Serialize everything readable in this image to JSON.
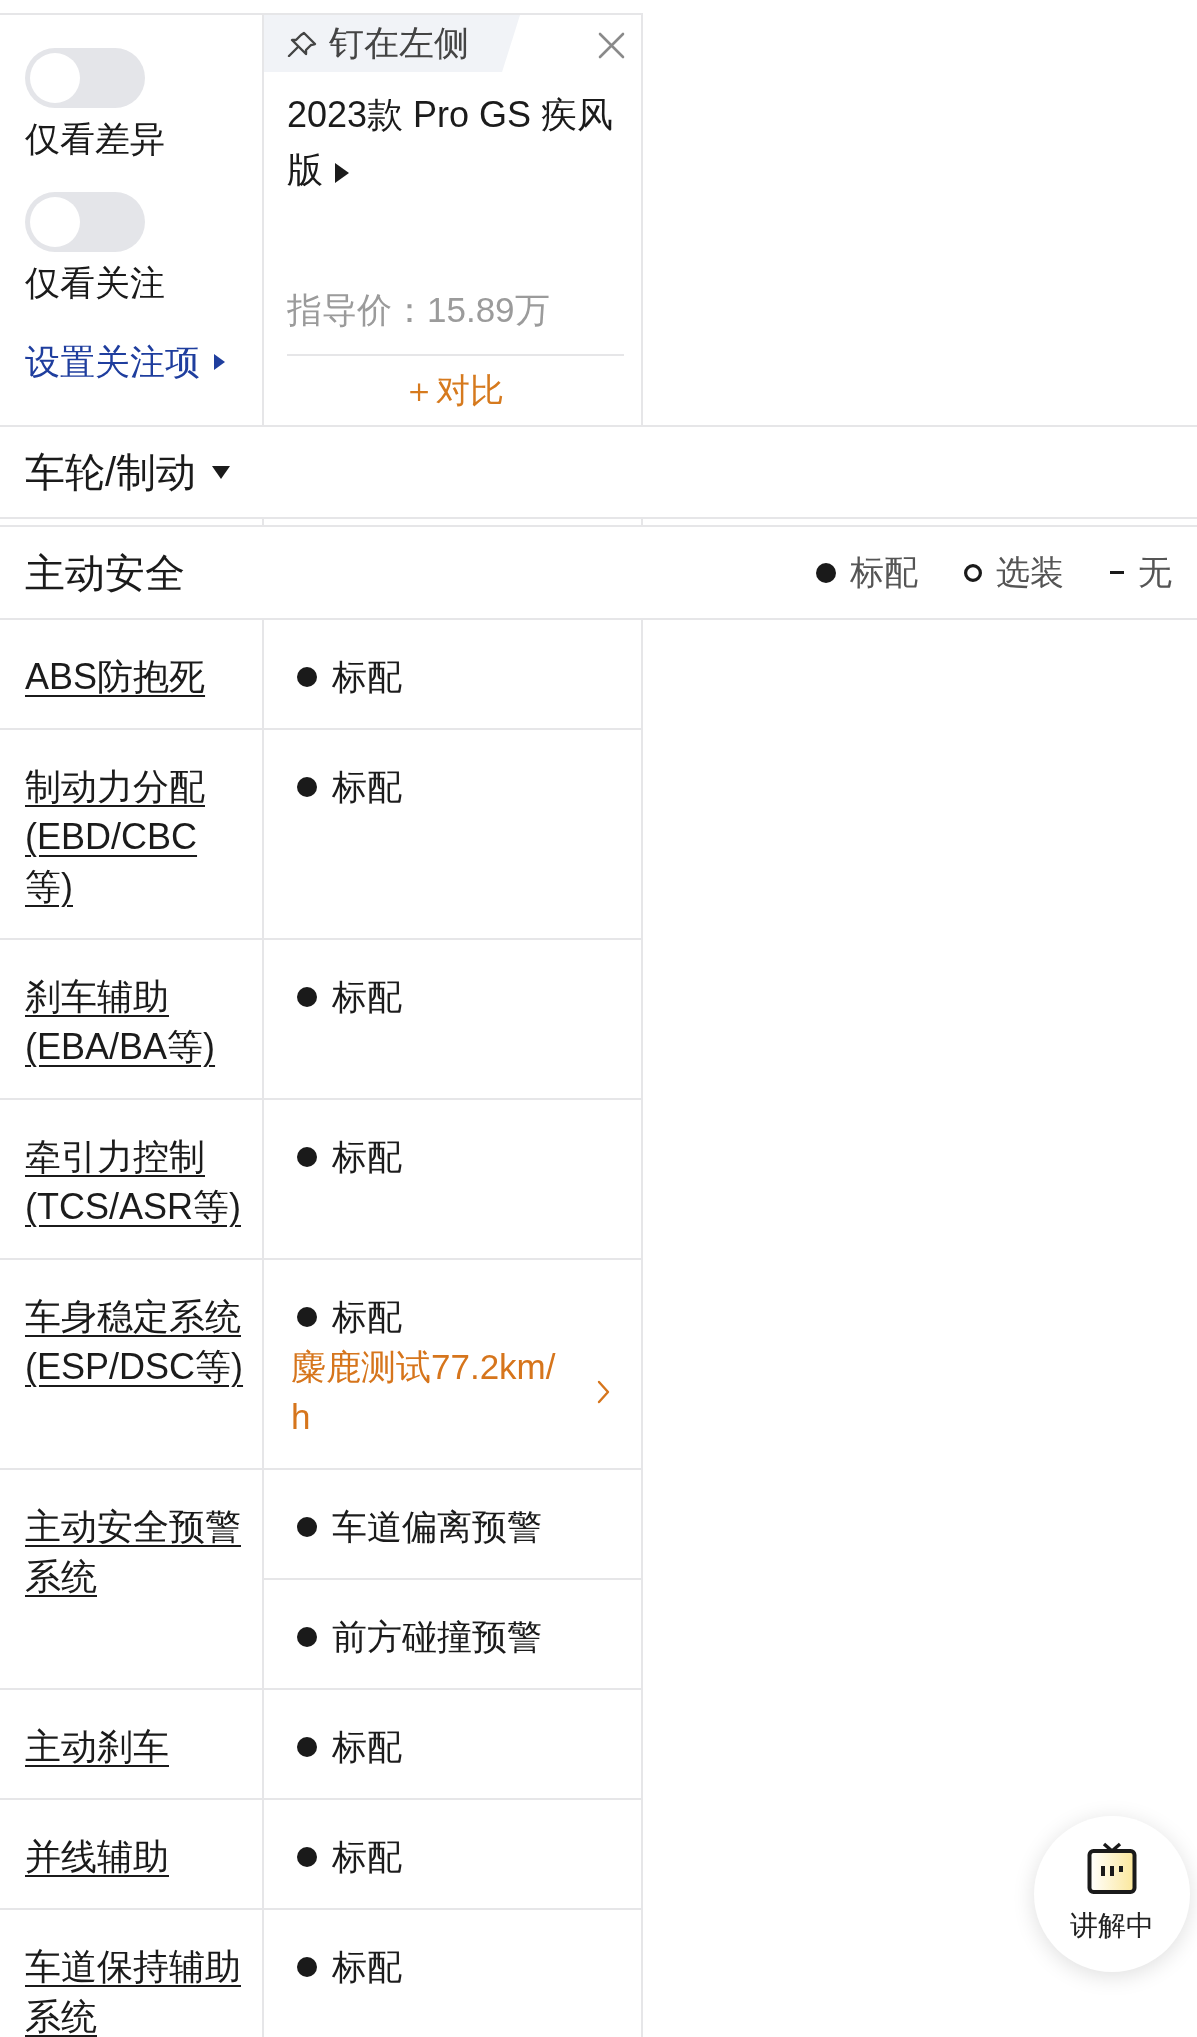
{
  "filters": {
    "toggles": [
      {
        "label": "仅看差异",
        "on": false
      },
      {
        "label": "仅看关注",
        "on": false
      }
    ],
    "settings_link": "设置关注项"
  },
  "car": {
    "pin_label": "钉在左侧",
    "title": "2023款 Pro GS 疾风版",
    "price": "指导价：15.89万",
    "compare_button": "＋对比"
  },
  "section": {
    "title": "车轮/制动"
  },
  "group": {
    "title": "主动安全",
    "legend": [
      {
        "kind": "standard",
        "label": "标配"
      },
      {
        "kind": "optional",
        "label": "选装"
      },
      {
        "kind": "none",
        "label": "无"
      }
    ]
  },
  "rows": [
    {
      "label": "ABS防抱死",
      "values": [
        {
          "kind": "standard",
          "text": "标配"
        }
      ]
    },
    {
      "label": "制动力分配(EBD/CBC等)",
      "values": [
        {
          "kind": "standard",
          "text": "标配"
        }
      ]
    },
    {
      "label": "刹车辅助(EBA/BA等)",
      "values": [
        {
          "kind": "standard",
          "text": "标配"
        }
      ]
    },
    {
      "label": "牵引力控制(TCS/ASR等)",
      "values": [
        {
          "kind": "standard",
          "text": "标配"
        }
      ]
    },
    {
      "label": "车身稳定系统(ESP/DSC等)",
      "values": [
        {
          "kind": "standard",
          "text": "标配",
          "note": "麋鹿测试77.2km/h"
        }
      ]
    },
    {
      "label": "主动安全预警系统",
      "values": [
        {
          "kind": "standard",
          "text": "车道偏离预警"
        },
        {
          "kind": "standard",
          "text": "前方碰撞预警"
        }
      ]
    },
    {
      "label": "主动刹车",
      "values": [
        {
          "kind": "standard",
          "text": "标配"
        }
      ]
    },
    {
      "label": "并线辅助",
      "values": [
        {
          "kind": "standard",
          "text": "标配"
        }
      ]
    },
    {
      "label": "车道保持辅助系统",
      "values": [
        {
          "kind": "standard",
          "text": "标配"
        }
      ]
    }
  ],
  "float_button": {
    "label": "讲解中"
  }
}
